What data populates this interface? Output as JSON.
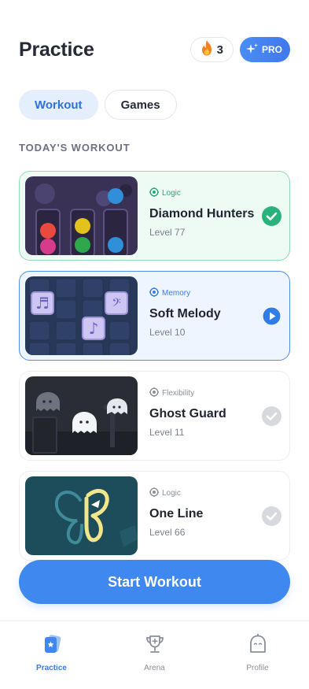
{
  "header": {
    "title": "Practice",
    "streak_count": "3",
    "pro_label": "PRO"
  },
  "segments": [
    {
      "label": "Workout",
      "active": true
    },
    {
      "label": "Games",
      "active": false
    }
  ],
  "section_title": "TODAY'S WORKOUT",
  "workout": [
    {
      "category": "Logic",
      "name": "Diamond Hunters",
      "level": "Level 77",
      "status": "completed",
      "icon": "check-circle-icon"
    },
    {
      "category": "Memory",
      "name": "Soft Melody",
      "level": "Level 10",
      "status": "current",
      "icon": "play-circle-icon"
    },
    {
      "category": "Flexibility",
      "name": "Ghost Guard",
      "level": "Level 11",
      "status": "pending",
      "icon": "check-circle-icon"
    },
    {
      "category": "Logic",
      "name": "One Line",
      "level": "Level 66",
      "status": "pending",
      "icon": "check-circle-icon"
    }
  ],
  "cta_label": "Start Workout",
  "tabs": [
    {
      "label": "Practice",
      "icon": "cards-icon",
      "active": true
    },
    {
      "label": "Arena",
      "icon": "trophy-icon",
      "active": false
    },
    {
      "label": "Profile",
      "icon": "ghost-icon",
      "active": false
    }
  ],
  "colors": {
    "accent": "#3f88ef",
    "completed": "#2ab27b",
    "streak_flame": "#f5821f"
  }
}
